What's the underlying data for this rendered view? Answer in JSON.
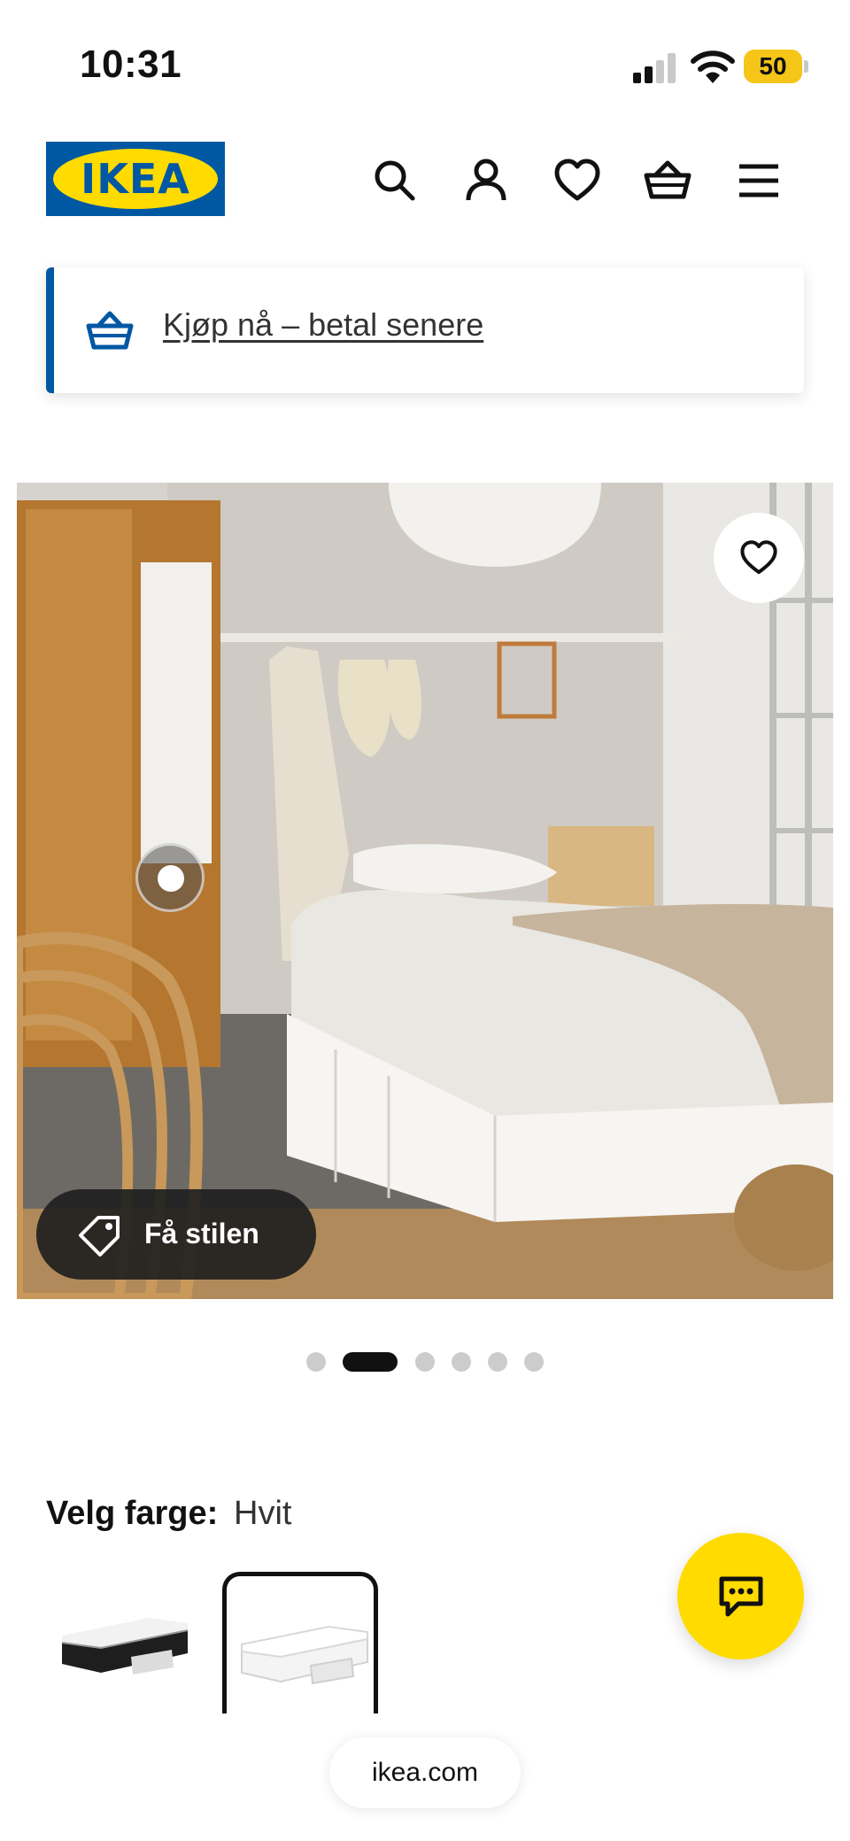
{
  "status_bar": {
    "time": "10:31",
    "battery": "50",
    "icons": [
      "cellular-signal-icon",
      "wifi-icon",
      "battery-icon"
    ]
  },
  "header": {
    "logo_text": "IKEA",
    "icons": [
      "search-icon",
      "account-icon",
      "heart-icon",
      "basket-icon",
      "menu-icon"
    ]
  },
  "promo": {
    "link_text": "Kjøp nå – betal senere",
    "icon": "basket-icon"
  },
  "product_image": {
    "favourite_icon": "heart-icon",
    "style_chip_label": "Få stilen",
    "style_chip_icon": "tag-icon"
  },
  "carousel": {
    "total": 6,
    "active_index": 1
  },
  "color_selector": {
    "label": "Velg farge:",
    "selected_value": "Hvit",
    "options": [
      {
        "name": "black",
        "selected": false
      },
      {
        "name": "white",
        "selected": true
      }
    ]
  },
  "chat": {
    "icon": "chat-icon"
  },
  "browser": {
    "url": "ikea.com"
  },
  "colors": {
    "ikea_blue": "#0058a3",
    "ikea_yellow": "#ffdb00",
    "dot_active": "#111111",
    "dot_inactive": "#cccccc"
  }
}
